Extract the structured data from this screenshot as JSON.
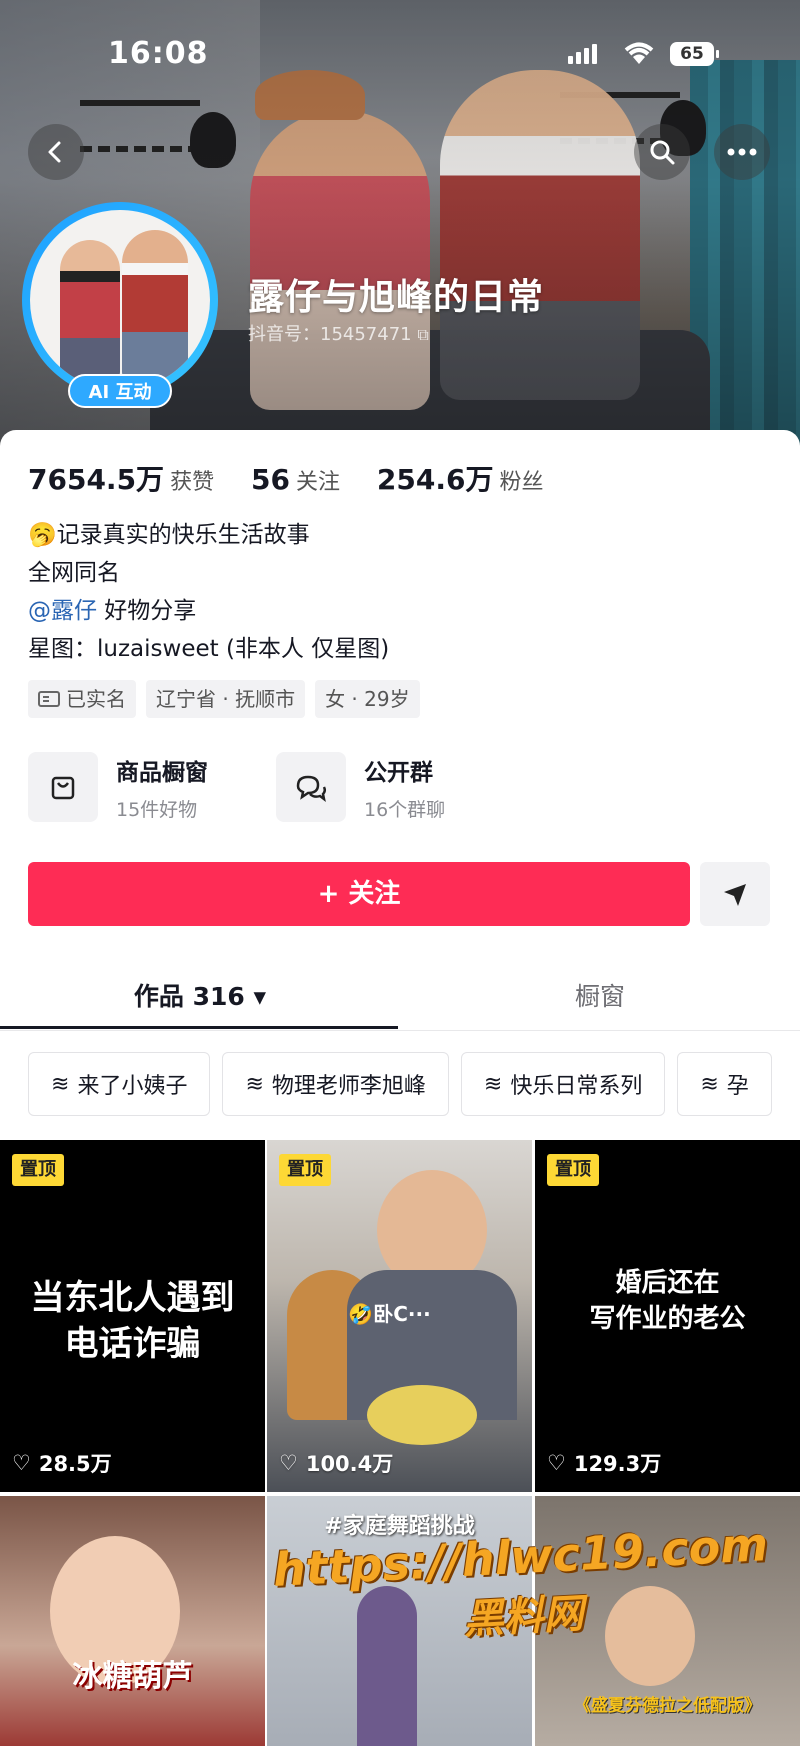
{
  "status": {
    "time": "16:08",
    "battery": "65"
  },
  "profile": {
    "name": "露仔与旭峰的日常",
    "douyin_id": "抖音号：15457471",
    "ai_badge": "AI 互动"
  },
  "stats": {
    "likes_value": "7654.5万",
    "likes_label": "获赞",
    "following_value": "56",
    "following_label": "关注",
    "followers_value": "254.6万",
    "followers_label": "粉丝"
  },
  "bio": {
    "line1": "记录真实的快乐生活故事",
    "line2": "全网同名",
    "mention": "@露仔",
    "mention_suffix": " 好物分享",
    "line4": "星图：luzaisweet (非本人 仅星图)"
  },
  "tags": [
    "已实名",
    "辽宁省 · 抚顺市",
    "女 · 29岁"
  ],
  "features": {
    "shop_title": "商品橱窗",
    "shop_sub": "15件好物",
    "group_title": "公开群",
    "group_sub": "16个群聊"
  },
  "follow_button": "+ 关注",
  "tabs": {
    "works": "作品 316 ▾",
    "showcase": "橱窗"
  },
  "chips": [
    "来了小姨子",
    "物理老师李旭峰",
    "快乐日常系列",
    "孕"
  ],
  "videos": [
    {
      "pin": "置顶",
      "title_line1": "当东北人遇到",
      "title_line2": "电话诈骗",
      "likes": "28.5万"
    },
    {
      "pin": "置顶",
      "caption": "🤣卧C···",
      "likes": "100.4万"
    },
    {
      "pin": "置顶",
      "title_line1": "婚后还在",
      "title_line2": "写作业的老公",
      "likes": "129.3万"
    }
  ],
  "videos_row2": [
    {
      "caption": "冰糖葫芦"
    },
    {
      "caption": "#家庭舞蹈挑战"
    },
    {
      "caption": "《盛夏芬德拉之低配版》"
    }
  ],
  "watermark": {
    "line1": "https://hlwc19.com",
    "line2": "黑料网"
  }
}
